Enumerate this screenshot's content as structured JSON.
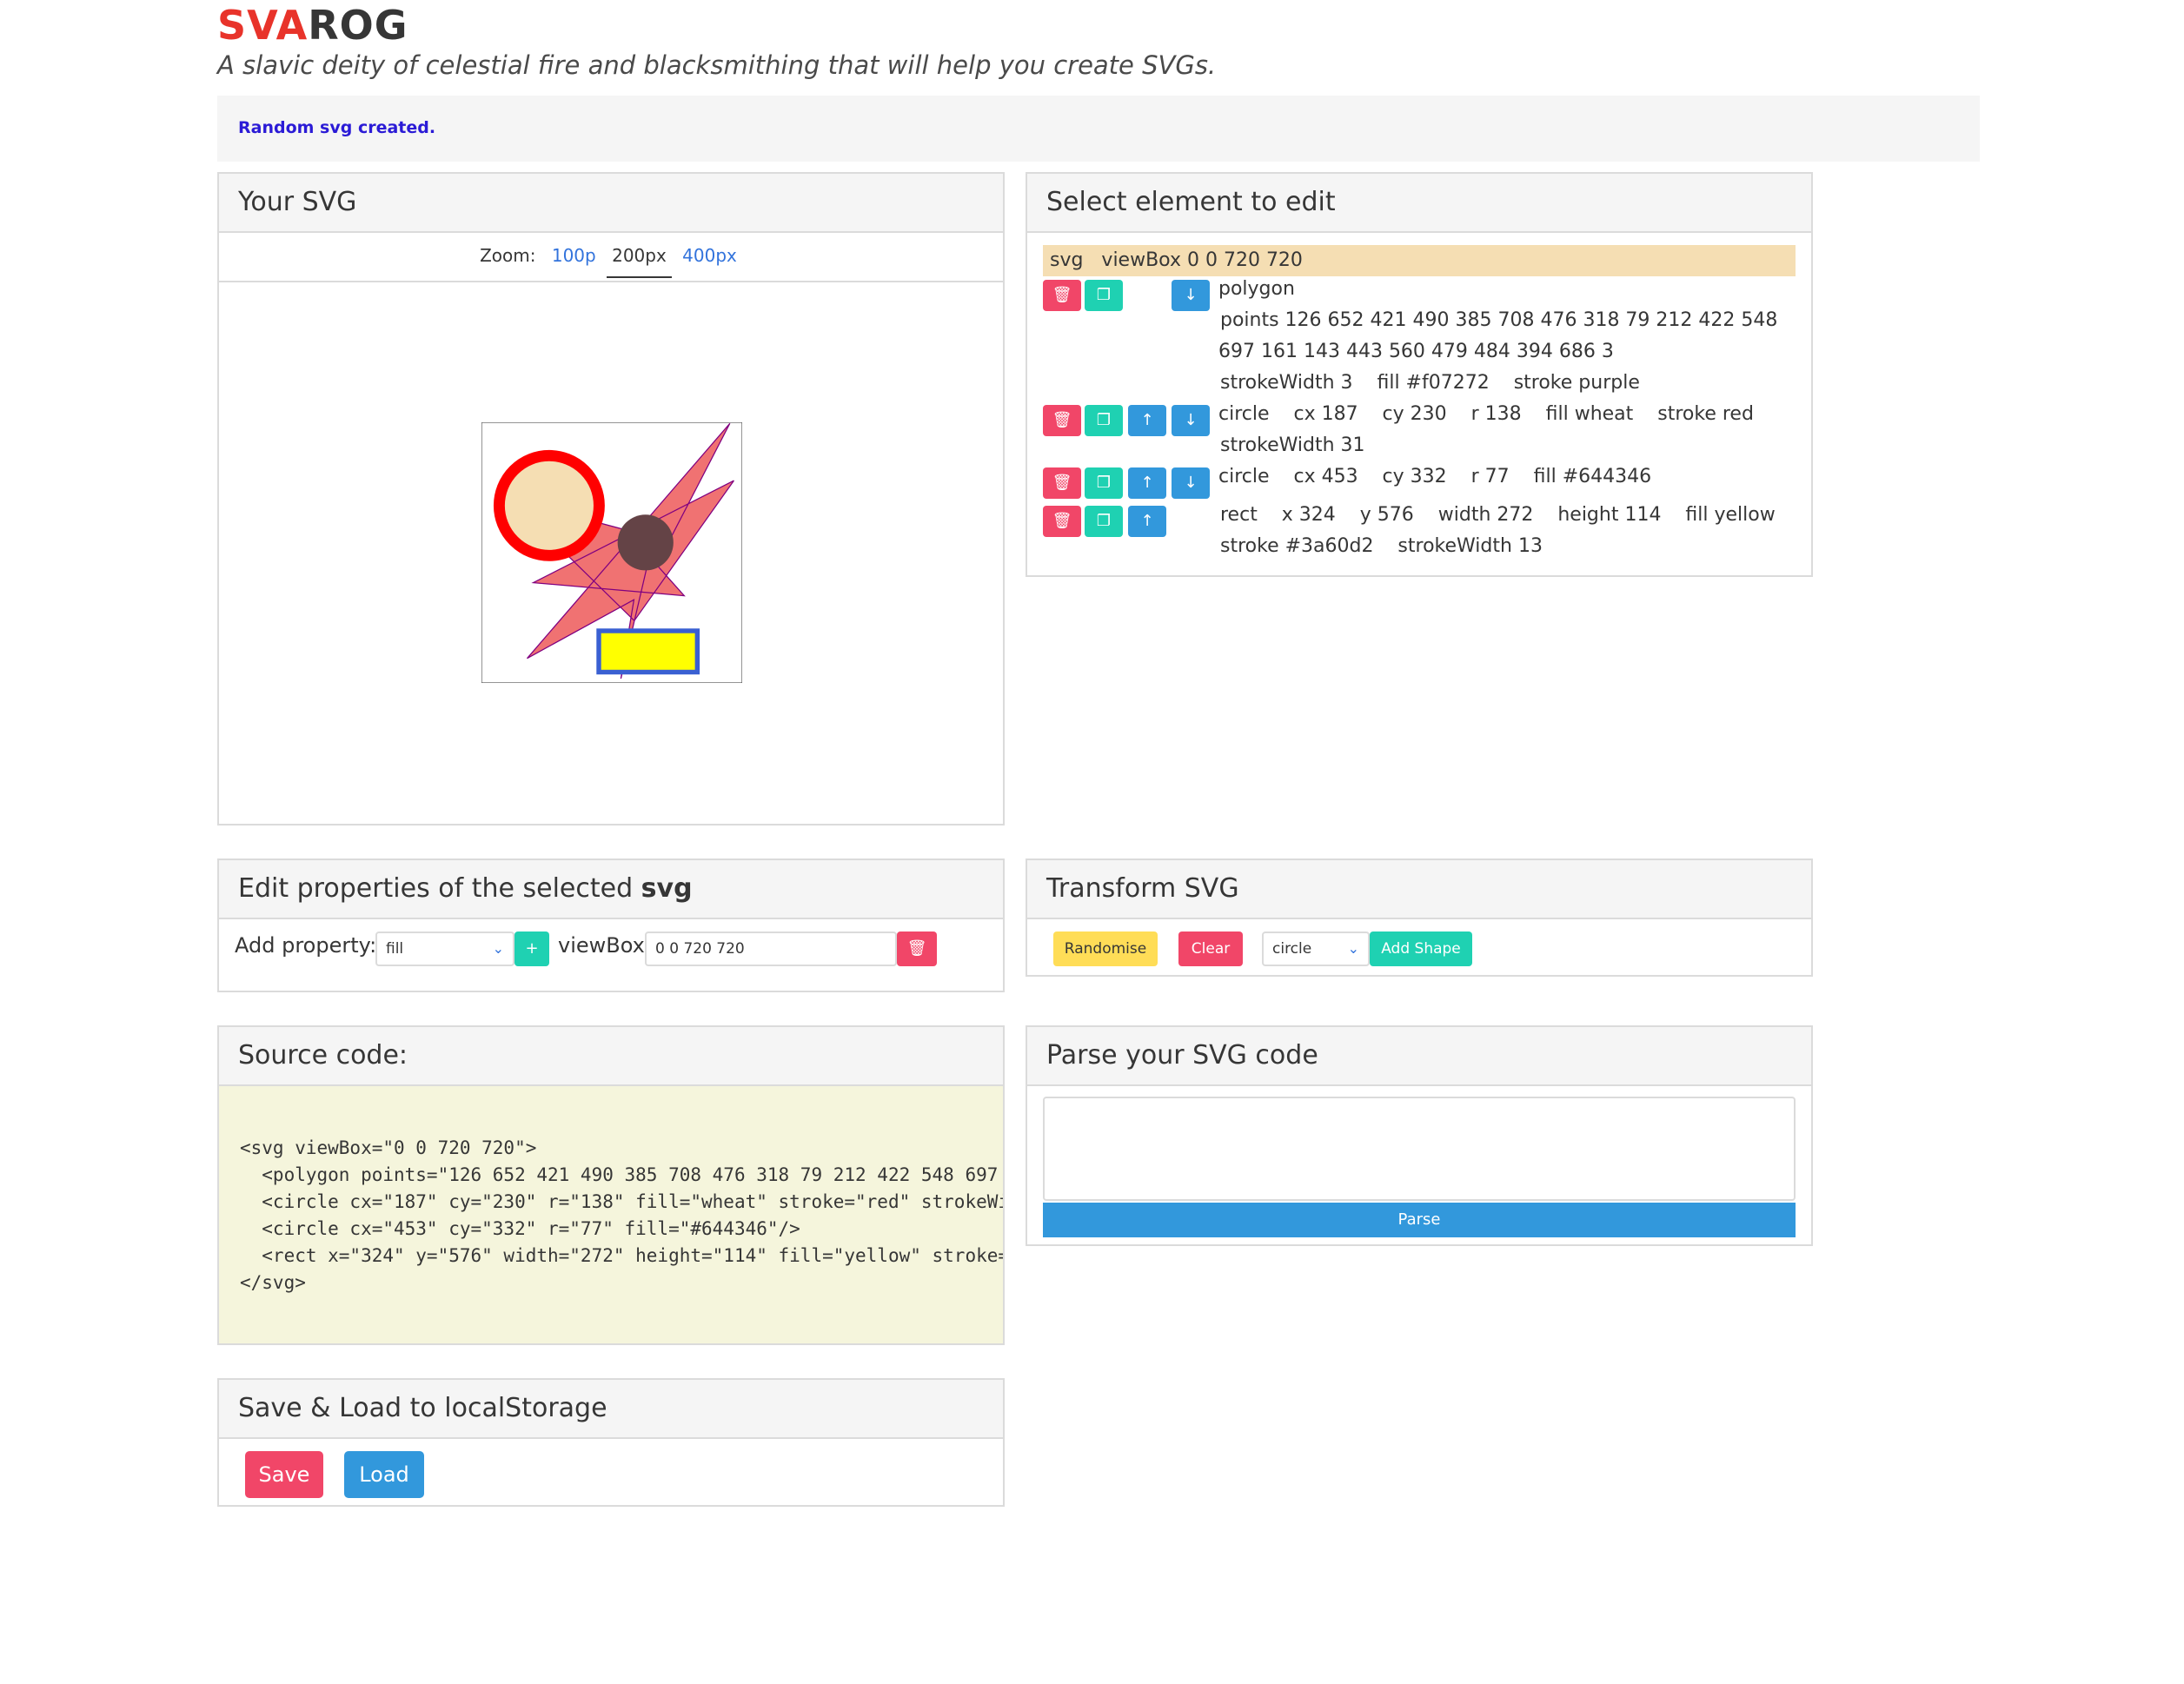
{
  "header": {
    "logo_part1": "SVA",
    "logo_part2": "ROG",
    "tagline": "A slavic deity of celestial fire and blacksmithing that will help you create SVGs."
  },
  "notice": "Random svg created.",
  "your_svg": {
    "title": "Your SVG",
    "zoom_label": "Zoom:",
    "zoom_options": [
      "100p",
      "200px",
      "400px"
    ],
    "zoom_selected": "200px"
  },
  "select_panel": {
    "title": "Select element to edit",
    "svg_row": "svg   viewBox 0 0 720 720",
    "elements": [
      {
        "line1": "polygon",
        "line2": "points 126 652 421 490 385 708 476 318 79 212 422 548",
        "line3": "697 161 143 443 560 479 484 394 686 3",
        "line4": "strokeWidth 3    fill #f07272    stroke purple"
      },
      {
        "line1": "circle    cx 187    cy 230    r 138    fill wheat    stroke red",
        "line2": "strokeWidth 31"
      },
      {
        "line1": "circle    cx 453    cy 332    r 77    fill #644346"
      },
      {
        "line1": "rect    x 324    y 576    width 272    height 114    fill yellow",
        "line2": "stroke #3a60d2    strokeWidth 13"
      }
    ]
  },
  "edit_panel": {
    "title_prefix": "Edit properties of the selected",
    "title_element": "svg",
    "add_property_label": "Add property:",
    "add_property_value": "fill",
    "add_button": "+",
    "viewbox_label": "viewBox:",
    "viewbox_value": "0 0 720 720"
  },
  "transform_panel": {
    "title": "Transform SVG",
    "randomise": "Randomise",
    "clear": "Clear",
    "shape_select": "circle",
    "add_shape": "Add Shape"
  },
  "source_panel": {
    "title": "Source code:",
    "code_lines": [
      "<svg viewBox=\"0 0 720 720\">",
      "  <polygon points=\"126 652 421 490 385 708 476 318 79 212 422 548 697",
      "  <circle cx=\"187\" cy=\"230\" r=\"138\" fill=\"wheat\" stroke=\"red\" strokeWi",
      "  <circle cx=\"453\" cy=\"332\" r=\"77\" fill=\"#644346\"/>",
      "  <rect x=\"324\" y=\"576\" width=\"272\" height=\"114\" fill=\"yellow\" stroke=",
      "</svg>"
    ]
  },
  "parse_panel": {
    "title": "Parse your SVG code",
    "textarea_value": "",
    "parse_button": "Parse"
  },
  "save_panel": {
    "title": "Save & Load to localStorage",
    "save": "Save",
    "load": "Load"
  },
  "colors": {
    "logo_accent": "#e8332a",
    "notice_text": "#2b1bd6",
    "danger": "#f14668",
    "success": "#1fd1b2",
    "info": "#3298dc",
    "warning": "#ffdd57",
    "source_bg": "#f5f5dc"
  }
}
